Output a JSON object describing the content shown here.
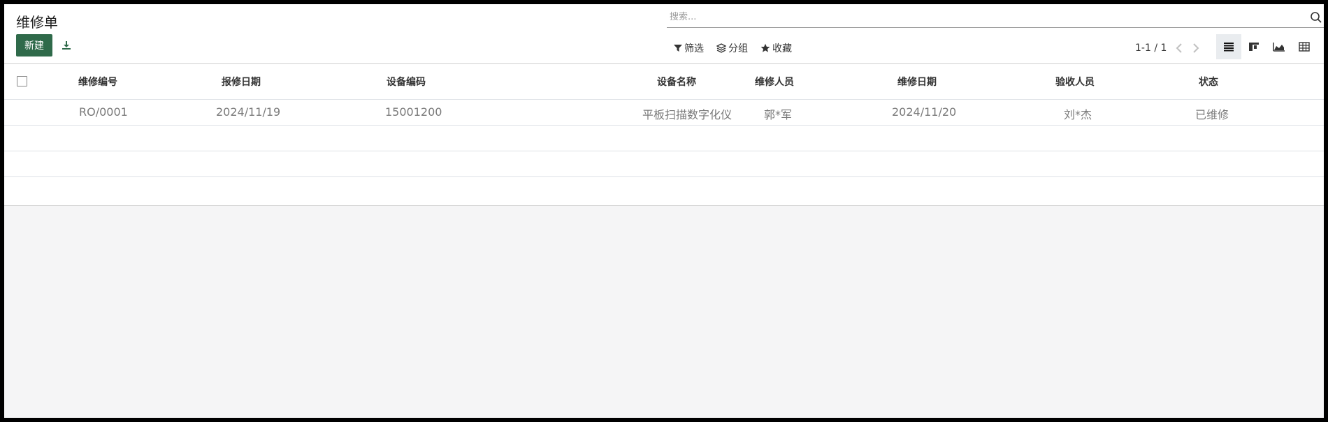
{
  "page": {
    "title": "维修单",
    "new_label": "新建"
  },
  "search": {
    "placeholder": "搜索..."
  },
  "facets": {
    "filter_label": "筛选",
    "group_label": "分组",
    "favorite_label": "收藏"
  },
  "pager": {
    "value": "1-1 / 1"
  },
  "table": {
    "headers": [
      "维修编号",
      "报修日期",
      "设备编码",
      "设备名称",
      "维修人员",
      "维修日期",
      "验收人员",
      "状态"
    ],
    "rows": [
      [
        "RO/0001",
        "2024/11/19",
        "15001200",
        "平板扫描数字化仪",
        "郭*军",
        "2024/11/20",
        "刘*杰",
        "已维修"
      ]
    ]
  },
  "colors": {
    "primary": "#2f6a4a",
    "background": "#f5f5f6"
  }
}
